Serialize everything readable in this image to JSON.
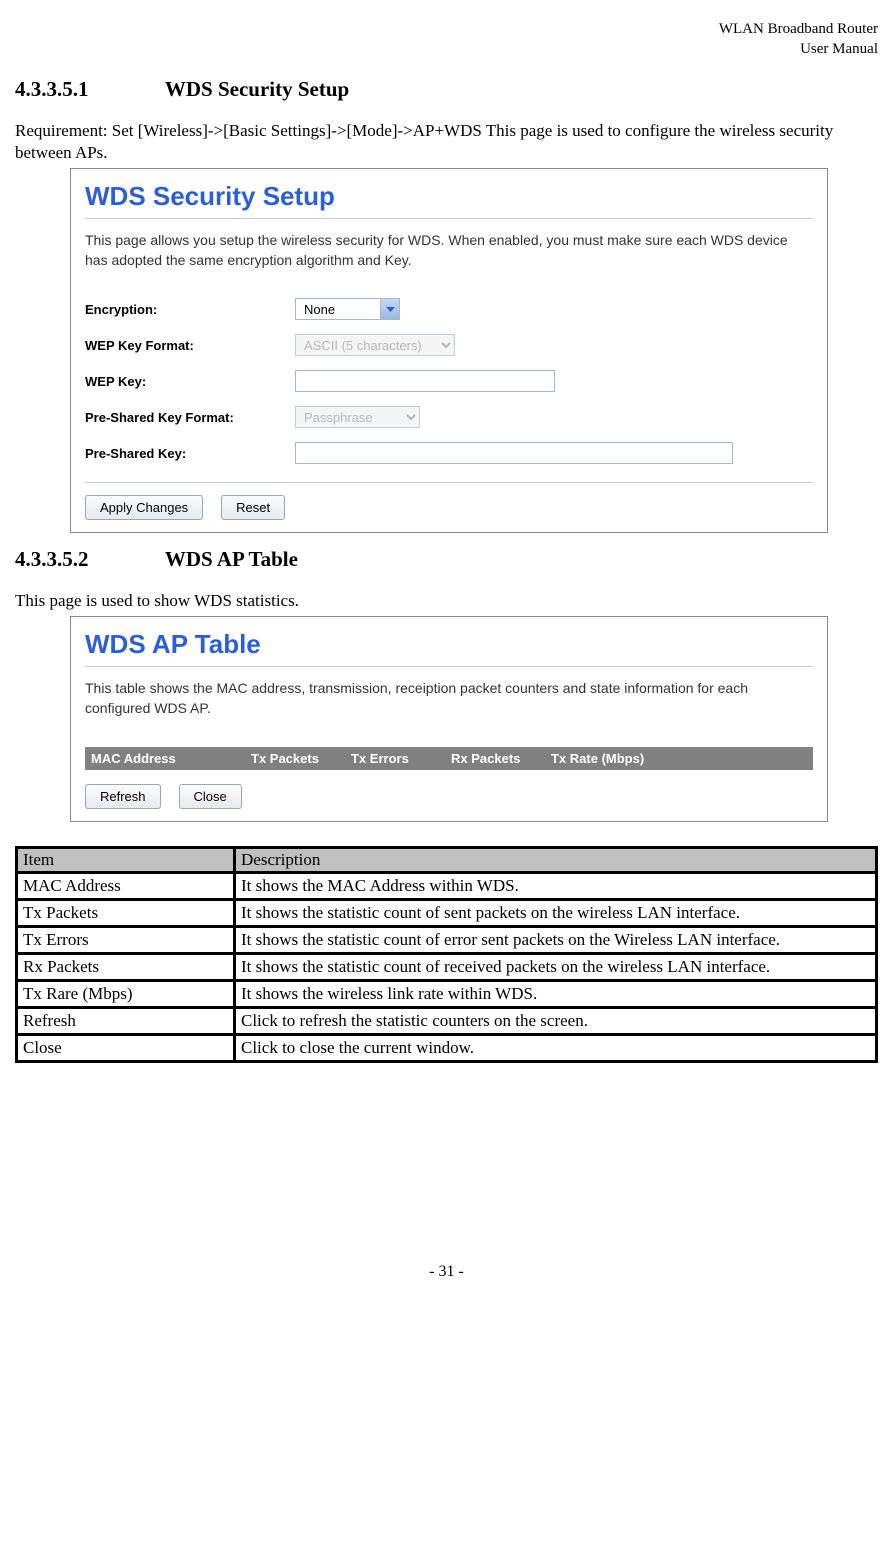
{
  "header": {
    "line1": "WLAN Broadband Router",
    "line2": "User Manual"
  },
  "section1": {
    "number": "4.3.3.5.1",
    "title": "WDS Security Setup"
  },
  "intro1": "Requirement: Set [Wireless]->[Basic Settings]->[Mode]->AP+WDS This page is used to configure the wireless security between APs.",
  "panel1": {
    "title": "WDS Security Setup",
    "desc": "This page allows you setup the wireless security for WDS. When enabled, you must make sure each WDS device has adopted the same encryption algorithm and Key.",
    "fields": {
      "encryption_label": "Encryption:",
      "encryption_value": "None",
      "wepfmt_label": "WEP Key Format:",
      "wepfmt_value": "ASCII (5 characters)",
      "wepkey_label": "WEP Key:",
      "wepkey_value": "",
      "pskfmt_label": "Pre-Shared Key Format:",
      "pskfmt_value": "Passphrase",
      "psk_label": "Pre-Shared Key:",
      "psk_value": ""
    },
    "buttons": {
      "apply": "Apply Changes",
      "reset": "Reset"
    }
  },
  "section2": {
    "number": "4.3.3.5.2",
    "title": "WDS AP Table"
  },
  "intro2": "This page is used to show WDS statistics.",
  "panel2": {
    "title": "WDS AP Table",
    "desc": "This table shows the MAC address, transmission, receiption packet counters and state information for each configured WDS AP.",
    "cols": {
      "c1": "MAC Address",
      "c2": "Tx Packets",
      "c3": "Tx Errors",
      "c4": "Rx Packets",
      "c5": "Tx Rate (Mbps)"
    },
    "buttons": {
      "refresh": "Refresh",
      "close": "Close"
    }
  },
  "table": {
    "headItem": "Item",
    "headDesc": "Description",
    "rows": [
      {
        "item": "MAC Address",
        "desc": "It shows the MAC Address within WDS."
      },
      {
        "item": "Tx Packets",
        "desc": "It shows the statistic count of sent packets on the wireless LAN interface."
      },
      {
        "item": "Tx Errors",
        "desc": "It shows the statistic count of error sent packets on the Wireless LAN interface."
      },
      {
        "item": "Rx Packets",
        "desc": "It shows the statistic count of received packets on the wireless LAN interface."
      },
      {
        "item": "Tx Rare (Mbps)",
        "desc": "It shows the wireless link rate within WDS."
      },
      {
        "item": "Refresh",
        "desc": "Click to refresh the statistic counters on the screen."
      },
      {
        "item": "Close",
        "desc": "Click to close the current window."
      }
    ]
  },
  "footer": "- 31 -"
}
